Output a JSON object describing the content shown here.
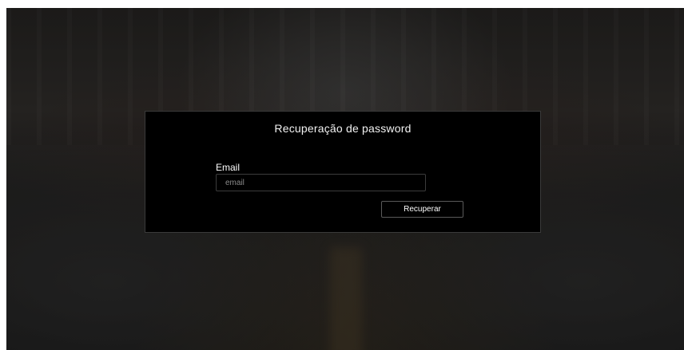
{
  "modal": {
    "title": "Recuperação de password",
    "email_label": "Email",
    "email_placeholder": "email",
    "email_value": "",
    "submit_label": "Recuperar"
  }
}
